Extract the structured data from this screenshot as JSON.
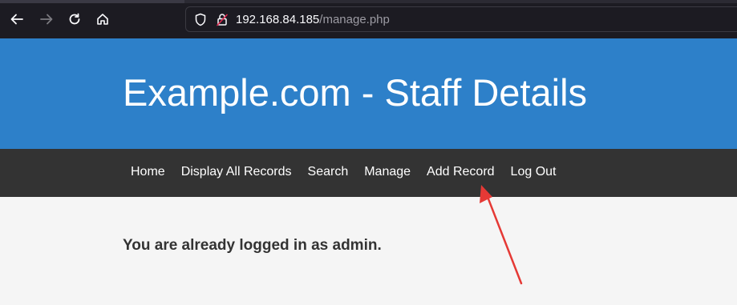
{
  "browser": {
    "url_host": "192.168.84.185",
    "url_path": "/manage.php",
    "icons": [
      "back-arrow-icon",
      "forward-arrow-icon",
      "reload-icon",
      "home-icon",
      "shield-icon",
      "insecure-lock-icon"
    ]
  },
  "header": {
    "title": "Example.com - Staff Details"
  },
  "nav": {
    "items": [
      {
        "label": "Home"
      },
      {
        "label": "Display All Records"
      },
      {
        "label": "Search"
      },
      {
        "label": "Manage"
      },
      {
        "label": "Add Record"
      },
      {
        "label": "Log Out"
      }
    ]
  },
  "main": {
    "message": "You are already logged in as admin."
  },
  "colors": {
    "header_bg": "#2d80c9",
    "nav_bg": "#333333",
    "page_bg": "#f5f5f5",
    "annotation_arrow": "#e53935"
  }
}
